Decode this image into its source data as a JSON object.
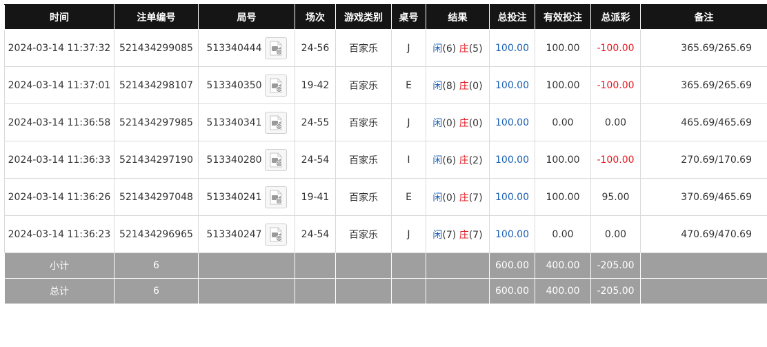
{
  "columns": [
    "时间",
    "注单编号",
    "局号",
    "场次",
    "游戏类别",
    "桌号",
    "结果",
    "总投注",
    "有效投注",
    "总派彩",
    "备注"
  ],
  "rows": [
    {
      "time": "2024-03-14 11:37:32",
      "bet_id": "521434299085",
      "round": "513340444",
      "session": "24-56",
      "game_type": "百家乐",
      "table": "J",
      "player_label": "闲",
      "player_score": "(6)",
      "banker_label": "庄",
      "banker_score": "(5)",
      "total_bet": "100.00",
      "valid_bet": "100.00",
      "payout": "-100.00",
      "remark": "365.69/265.69"
    },
    {
      "time": "2024-03-14 11:37:01",
      "bet_id": "521434298107",
      "round": "513340350",
      "session": "19-42",
      "game_type": "百家乐",
      "table": "E",
      "player_label": "闲",
      "player_score": "(8)",
      "banker_label": "庄",
      "banker_score": "(0)",
      "total_bet": "100.00",
      "valid_bet": "100.00",
      "payout": "-100.00",
      "remark": "365.69/265.69"
    },
    {
      "time": "2024-03-14 11:36:58",
      "bet_id": "521434297985",
      "round": "513340341",
      "session": "24-55",
      "game_type": "百家乐",
      "table": "J",
      "player_label": "闲",
      "player_score": "(0)",
      "banker_label": "庄",
      "banker_score": "(0)",
      "total_bet": "100.00",
      "valid_bet": "0.00",
      "payout": "0.00",
      "remark": "465.69/465.69"
    },
    {
      "time": "2024-03-14 11:36:33",
      "bet_id": "521434297190",
      "round": "513340280",
      "session": "24-54",
      "game_type": "百家乐",
      "table": "I",
      "player_label": "闲",
      "player_score": "(6)",
      "banker_label": "庄",
      "banker_score": "(2)",
      "total_bet": "100.00",
      "valid_bet": "100.00",
      "payout": "-100.00",
      "remark": "270.69/170.69"
    },
    {
      "time": "2024-03-14 11:36:26",
      "bet_id": "521434297048",
      "round": "513340241",
      "session": "19-41",
      "game_type": "百家乐",
      "table": "E",
      "player_label": "闲",
      "player_score": "(0)",
      "banker_label": "庄",
      "banker_score": "(7)",
      "total_bet": "100.00",
      "valid_bet": "100.00",
      "payout": "95.00",
      "remark": "370.69/465.69"
    },
    {
      "time": "2024-03-14 11:36:23",
      "bet_id": "521434296965",
      "round": "513340247",
      "session": "24-54",
      "game_type": "百家乐",
      "table": "J",
      "player_label": "闲",
      "player_score": "(7)",
      "banker_label": "庄",
      "banker_score": "(7)",
      "total_bet": "100.00",
      "valid_bet": "0.00",
      "payout": "0.00",
      "remark": "470.69/470.69"
    }
  ],
  "subtotal": {
    "label": "小计",
    "count": "6",
    "total_bet": "600.00",
    "valid_bet": "400.00",
    "payout": "-205.00"
  },
  "grand_total": {
    "label": "总计",
    "count": "6",
    "total_bet": "600.00",
    "valid_bet": "400.00",
    "payout": "-205.00"
  },
  "icons": {
    "replay": "film-replay-icon"
  },
  "colors": {
    "header_bg": "#151515",
    "footer_bg": "#9f9f9f",
    "bet_blue": "#1a5fb4",
    "negative_red": "#e3151d"
  }
}
